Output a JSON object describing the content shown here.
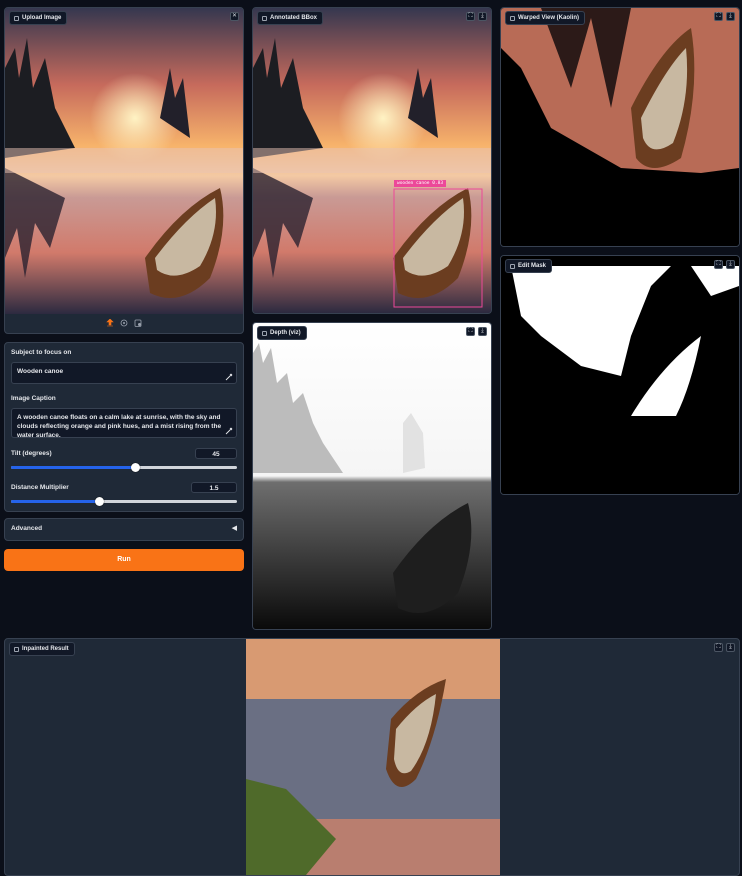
{
  "upload": {
    "label": "Upload Image",
    "icons": [
      "upload-icon",
      "webcam-icon",
      "clipboard-icon"
    ]
  },
  "annotated": {
    "label": "Annotated BBox",
    "bbox_label": "wooden canoe 0.83"
  },
  "warped": {
    "label": "Warped View (Kaolin)"
  },
  "edit_mask": {
    "label": "Edit Mask"
  },
  "depth": {
    "label": "Depth (viz)"
  },
  "inpainted": {
    "label": "Inpainted Result"
  },
  "controls": {
    "subject_label": "Subject to focus on",
    "subject_value": "Wooden canoe",
    "caption_label": "Image Caption",
    "caption_value": "A wooden canoe floats on a calm lake at sunrise, with the sky and clouds reflecting orange and pink hues, and a mist rising from the water surface.",
    "tilt_label": "Tilt (degrees)",
    "tilt_value": "45",
    "tilt_fraction": 0.55,
    "distance_label": "Distance Multiplier",
    "distance_value": "1.5",
    "distance_fraction": 0.39,
    "advanced_label": "Advanced",
    "run_label": "Run"
  },
  "colors": {
    "accent": "#f97316",
    "slider": "#2563eb",
    "bbox": "#ec4899"
  }
}
